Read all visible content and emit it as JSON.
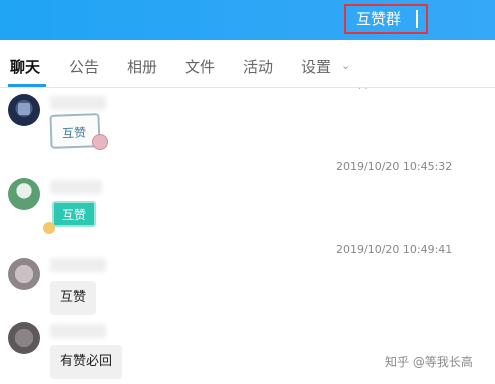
{
  "header": {
    "group_title": "互赞群"
  },
  "tabs": [
    "聊天",
    "公告",
    "相册",
    "文件",
    "活动",
    "设置"
  ],
  "messages": [
    {
      "sticker_text": "互赞"
    },
    {
      "timestamp": "2019/10/20 10:45:32",
      "sticker_text": "互赞"
    },
    {
      "timestamp": "2019/10/20 10:49:41",
      "text": "互赞"
    },
    {
      "text": "有赞必回"
    }
  ],
  "top_partial": "· ·",
  "watermark": "知乎 @等我长高",
  "colors": {
    "header": "#2aa6f6",
    "highlight_border": "#e0363c",
    "tab_active": "#1e9af0"
  }
}
